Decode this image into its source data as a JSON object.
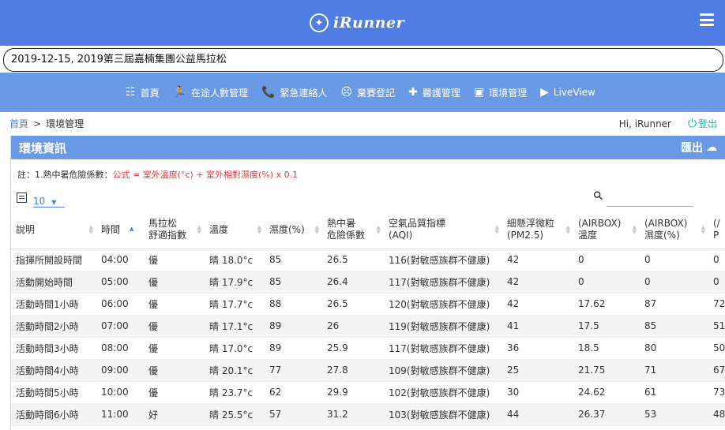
{
  "brand": {
    "logo_icon": "runner-badge-icon",
    "name": "iRunner"
  },
  "event": {
    "selected": "2019-12-15, 2019第三屆嘉楠集團公益馬拉松"
  },
  "nav": [
    {
      "icon": "grid-icon",
      "glyph": "☷",
      "label": "首頁"
    },
    {
      "icon": "runner-icon",
      "glyph": "🏃",
      "label": "在途人數管理"
    },
    {
      "icon": "phone-icon",
      "glyph": "📞",
      "label": "緊急連絡人"
    },
    {
      "icon": "face-icon",
      "glyph": "☹",
      "label": "棄賽登記"
    },
    {
      "icon": "medical-cross-icon",
      "glyph": "✚",
      "label": "醫護管理"
    },
    {
      "icon": "image-icon",
      "glyph": "▣",
      "label": "環境管理"
    },
    {
      "icon": "tv-play-icon",
      "glyph": "▶",
      "label": "LiveView"
    }
  ],
  "breadcrumb": {
    "home": "首頁",
    "sep": ">",
    "current": "環境管理"
  },
  "user": {
    "greeting": "Hi, iRunner",
    "logout": "登出"
  },
  "panel": {
    "title": "環境資訊",
    "export_label": "匯出",
    "note_prefix": "註：1.熱中暑危險係數：",
    "note_formula": "公式 = 室外溫度(°c) + 室外相對濕度(%) x 0.1",
    "page_length": "10",
    "search_placeholder": ""
  },
  "table": {
    "columns": [
      {
        "line1": "說明",
        "line2": ""
      },
      {
        "line1": "時間",
        "line2": ""
      },
      {
        "line1": "馬拉松",
        "line2": "舒適指數"
      },
      {
        "line1": "溫度",
        "line2": ""
      },
      {
        "line1": "濕度(%)",
        "line2": ""
      },
      {
        "line1": "熱中暑",
        "line2": "危險係數"
      },
      {
        "line1": "空氣品質指標",
        "line2": "(AQI)"
      },
      {
        "line1": "細懸浮微粒",
        "line2": "(PM2.5)"
      },
      {
        "line1": "(AIRBOX)",
        "line2": "溫度"
      },
      {
        "line1": "(AIRBOX)",
        "line2": "濕度(%)"
      },
      {
        "line1": "(/",
        "line2": "P"
      }
    ],
    "rows": [
      [
        "指揮所開設時間",
        "04:00",
        "優",
        "晴 18.0°c",
        "85",
        "26.5",
        "116(對敏感族群不健康)",
        "42",
        "0",
        "0",
        "0"
      ],
      [
        "活動開始時間",
        "05:00",
        "優",
        "晴 17.9°c",
        "85",
        "26.4",
        "117(對敏感族群不健康)",
        "42",
        "0",
        "0",
        "0"
      ],
      [
        "活動時間1小時",
        "06:00",
        "優",
        "晴 17.7°c",
        "88",
        "26.5",
        "120(對敏感族群不健康)",
        "42",
        "17.62",
        "87",
        "72"
      ],
      [
        "活動時間2小時",
        "07:00",
        "優",
        "晴 17.1°c",
        "89",
        "26",
        "119(對敏感族群不健康)",
        "41",
        "17.5",
        "85",
        "51"
      ],
      [
        "活動時間3小時",
        "08:00",
        "優",
        "晴 17.0°c",
        "89",
        "25.9",
        "117(對敏感族群不健康)",
        "36",
        "18.5",
        "80",
        "50"
      ],
      [
        "活動時間4小時",
        "09:00",
        "優",
        "晴 20.1°c",
        "77",
        "27.8",
        "109(對敏感族群不健康)",
        "25",
        "21.75",
        "71",
        "67"
      ],
      [
        "活動時間5小時",
        "10:00",
        "優",
        "晴 23.7°c",
        "62",
        "29.9",
        "102(對敏感族群不健康)",
        "30",
        "24.62",
        "61",
        "73"
      ],
      [
        "活動時間6小時",
        "11:00",
        "好",
        "晴 25.5°c",
        "57",
        "31.2",
        "103(對敏感族群不健康)",
        "44",
        "26.37",
        "53",
        "48"
      ]
    ]
  }
}
